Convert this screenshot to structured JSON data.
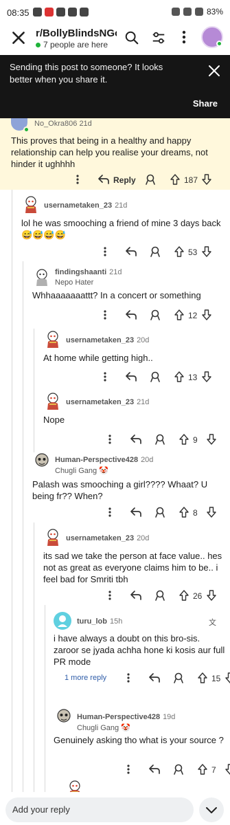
{
  "status_bar": {
    "time": "08:35",
    "battery": "83%"
  },
  "header": {
    "title": "r/BollyBlindsNGo...",
    "online": "7 people are here"
  },
  "banner": {
    "text": "Sending this post to someone? It looks better when you share it.",
    "share": "Share"
  },
  "highlighted_comment": {
    "username": "No_Okra806",
    "time": "21d",
    "body": "This proves that being in a healthy and happy relationship can help you realise your dreams, not hinder it ughhhh",
    "reply_label": "Reply",
    "votes": "187"
  },
  "comments": [
    {
      "username": "usernametaken_23",
      "time": "21d",
      "flair": "",
      "body": "lol he was smooching a friend of mine 3 days back 😅😅😅😅",
      "votes": "53"
    },
    {
      "username": "findingshaanti",
      "time": "21d",
      "flair": "Nepo Hater",
      "body": "Whhaaaaaaattt? In a concert or something",
      "votes": "12"
    },
    {
      "username": "usernametaken_23",
      "time": "20d",
      "flair": "",
      "body": "At home while getting high..",
      "votes": "13"
    },
    {
      "username": "usernametaken_23",
      "time": "21d",
      "flair": "",
      "body": "Nope",
      "votes": "9"
    },
    {
      "username": "Human-Perspective428",
      "time": "20d",
      "flair": "Chugli Gang 🤡",
      "body": "Palash was smooching a girl???? Whaat? U being fr?? When?",
      "votes": "8"
    },
    {
      "username": "usernametaken_23",
      "time": "20d",
      "flair": "",
      "body": "its sad we take the person at face value.. hes not as great as everyone claims him to be.. i feel bad for Smriti tbh",
      "votes": "26"
    },
    {
      "username": "turu_lob",
      "time": "15h",
      "flair": "",
      "body": "i have always a doubt on this bro-sis. zaroor se jyada achha hone ki kosis aur full PR mode",
      "votes": "15"
    },
    {
      "username": "Human-Perspective428",
      "time": "19d",
      "flair": "Chugli Gang 🤡",
      "body": "Genuinely asking tho what is your source ?",
      "votes": "7"
    }
  ],
  "more_replies": "1 more reply",
  "bottom": {
    "reply_placeholder": "Add your reply"
  }
}
